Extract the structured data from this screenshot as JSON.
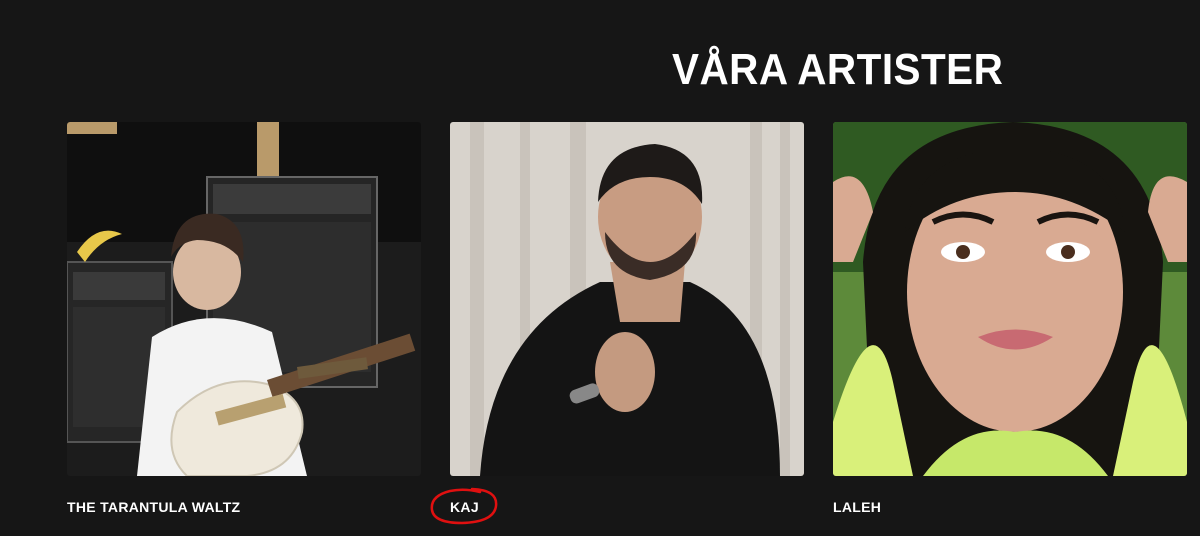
{
  "section": {
    "title": "VÅRA ARTISTER"
  },
  "artists": [
    {
      "name": "THE TARANTULA WALTZ",
      "photo": "musician-with-guitar-photo"
    },
    {
      "name": "KAJ",
      "photo": "man-in-black-shirt-photo"
    },
    {
      "name": "LALEH",
      "photo": "woman-portrait-photo"
    }
  ],
  "annotation": {
    "color": "#e01010",
    "target": "KAJ"
  }
}
